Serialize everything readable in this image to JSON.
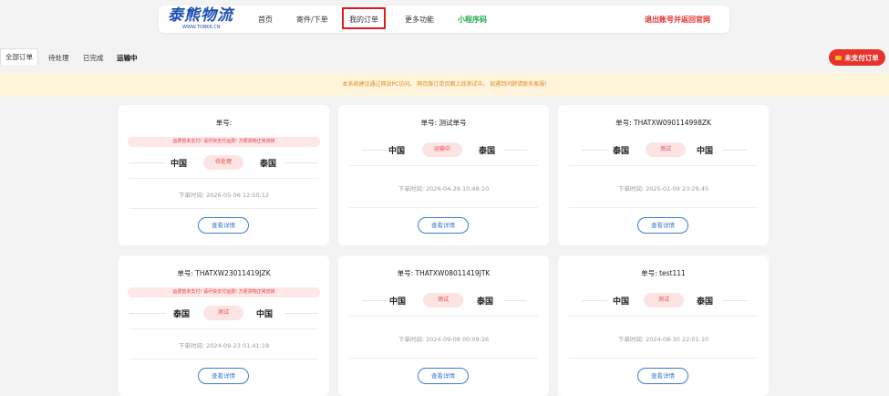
{
  "nav": {
    "logo_text": "泰熊物流",
    "logo_sub": "WWW.TOBKK.CN",
    "items": [
      "首页",
      "寄件/下单",
      "我的订单",
      "更多功能",
      "小程序码"
    ],
    "logout": "退出账号并返回官网"
  },
  "tabs": [
    "全部订单",
    "待处理",
    "已完成",
    "运输中"
  ],
  "unpaid_button": "未支付订单",
  "notice": "本系统建议通过网站PC访问。 网页版订单页面上线测试中。 如遇到问题请联系客服!",
  "detail_label": "查看详情",
  "cards": [
    {
      "order_no": "单号:",
      "warning": "运费暂未支付! 请尽快支付运费! 方便货物正常流转",
      "from": "中国",
      "to": "泰国",
      "status": "待处理",
      "time": "下单时间: 2026-05-06 12:50:12"
    },
    {
      "order_no": "单号: 测试单号",
      "warning": "",
      "from": "中国",
      "to": "泰国",
      "status": "运输中",
      "time": "下单时间: 2026-04-28 10:48:10"
    },
    {
      "order_no": "单号: THATXW090114998ZK",
      "warning": "",
      "from": "泰国",
      "to": "中国",
      "status": "测试",
      "time": "下单时间: 2025-01-09 23:29:45"
    },
    {
      "order_no": "单号: THATXW23011419JZK",
      "warning": "运费暂未支付! 请尽快支付运费! 方便货物正常流转",
      "from": "泰国",
      "to": "中国",
      "status": "测试",
      "time": "下单时间: 2024-09-23 01:41:19"
    },
    {
      "order_no": "单号: THATXW08011419JTK",
      "warning": "",
      "from": "中国",
      "to": "泰国",
      "status": "测试",
      "time": "下单时间: 2024-09-08 00:09:26"
    },
    {
      "order_no": "单号: test111",
      "warning": "",
      "from": "中国",
      "to": "泰国",
      "status": "测试",
      "time": "下单时间: 2024-08-30 22:01:10"
    }
  ]
}
